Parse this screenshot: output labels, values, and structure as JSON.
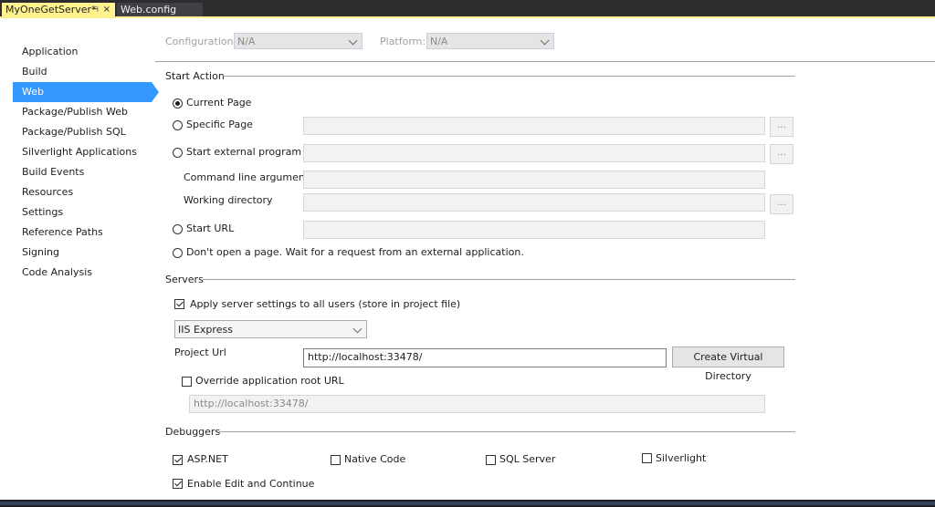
{
  "tabs": {
    "active": {
      "label": "MyOneGetServer*",
      "pin": "⊣",
      "close": "×"
    },
    "inactive": {
      "label": "Web.config"
    }
  },
  "sidebar": {
    "items": [
      {
        "label": "Application"
      },
      {
        "label": "Build"
      },
      {
        "label": "Web",
        "selected": true
      },
      {
        "label": "Package/Publish Web"
      },
      {
        "label": "Package/Publish SQL"
      },
      {
        "label": "Silverlight Applications"
      },
      {
        "label": "Build Events"
      },
      {
        "label": "Resources"
      },
      {
        "label": "Settings"
      },
      {
        "label": "Reference Paths"
      },
      {
        "label": "Signing"
      },
      {
        "label": "Code Analysis"
      }
    ]
  },
  "config": {
    "configuration_label": "Configuration:",
    "configuration_value": "N/A",
    "platform_label": "Platform:",
    "platform_value": "N/A"
  },
  "start_action": {
    "title": "Start Action",
    "current_page": "Current Page",
    "specific_page": "Specific Page",
    "start_external_program": "Start external program",
    "command_line_arguments": "Command line arguments",
    "working_directory": "Working directory",
    "start_url": "Start URL",
    "dont_open": "Don't open a page.  Wait for a request from an external application.",
    "browse_label": "...",
    "selected": "current_page"
  },
  "servers": {
    "title": "Servers",
    "apply_settings": "Apply server settings to all users (store in project file)",
    "apply_checked": true,
    "server_type": "IIS Express",
    "project_url_label": "Project Url",
    "project_url_value": "http://localhost:33478/",
    "create_vdir": "Create Virtual Directory",
    "override_label": "Override application root URL",
    "override_checked": false,
    "override_value": "http://localhost:33478/"
  },
  "debuggers": {
    "title": "Debuggers",
    "asp_net": "ASP.NET",
    "asp_net_checked": true,
    "native_code": "Native Code",
    "native_code_checked": false,
    "sql_server": "SQL Server",
    "sql_server_checked": false,
    "silverlight": "Silverlight",
    "silverlight_checked": false,
    "edit_continue": "Enable Edit and Continue",
    "edit_continue_checked": true
  },
  "colors": {
    "accent": "#3399ff",
    "tab_active": "#fff28f",
    "chrome": "#2d2d30"
  }
}
